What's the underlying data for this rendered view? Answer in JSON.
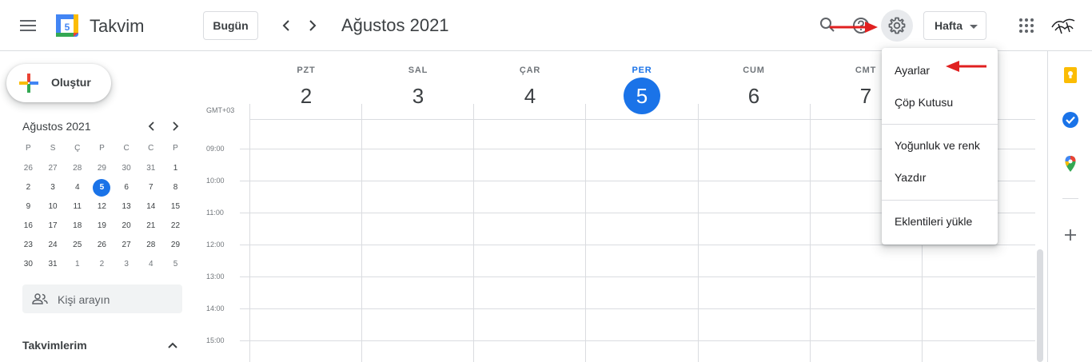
{
  "header": {
    "app_title": "Takvim",
    "logo_day": "5",
    "today_label": "Bugün",
    "month_title": "Ağustos 2021",
    "view_label": "Hafta"
  },
  "sidebar": {
    "create_label": "Oluştur",
    "mini_cal": {
      "title": "Ağustos 2021",
      "weekdays": [
        "P",
        "S",
        "Ç",
        "P",
        "C",
        "C",
        "P"
      ],
      "weeks": [
        [
          "26",
          "27",
          "28",
          "29",
          "30",
          "31",
          "1"
        ],
        [
          "2",
          "3",
          "4",
          "5",
          "6",
          "7",
          "8"
        ],
        [
          "9",
          "10",
          "11",
          "12",
          "13",
          "14",
          "15"
        ],
        [
          "16",
          "17",
          "18",
          "19",
          "20",
          "21",
          "22"
        ],
        [
          "23",
          "24",
          "25",
          "26",
          "27",
          "28",
          "29"
        ],
        [
          "30",
          "31",
          "1",
          "2",
          "3",
          "4",
          "5"
        ]
      ]
    },
    "people_search_placeholder": "Kişi arayın",
    "my_calendars_label": "Takvimlerim"
  },
  "week": {
    "timezone": "GMT+03",
    "days": [
      {
        "name": "PZT",
        "date": "2"
      },
      {
        "name": "SAL",
        "date": "3"
      },
      {
        "name": "ÇAR",
        "date": "4"
      },
      {
        "name": "PER",
        "date": "5"
      },
      {
        "name": "CUM",
        "date": "6"
      },
      {
        "name": "CMT",
        "date": "7"
      }
    ],
    "hours": [
      "09:00",
      "10:00",
      "11:00",
      "12:00",
      "13:00",
      "14:00",
      "15:00"
    ]
  },
  "settings_menu": {
    "items": [
      "Ayarlar",
      "Çöp Kutusu",
      "Yoğunluk ve renk",
      "Yazdır",
      "Eklentileri yükle"
    ]
  },
  "colors": {
    "accent": "#1a73e8",
    "annotation_arrow": "#e02020"
  }
}
